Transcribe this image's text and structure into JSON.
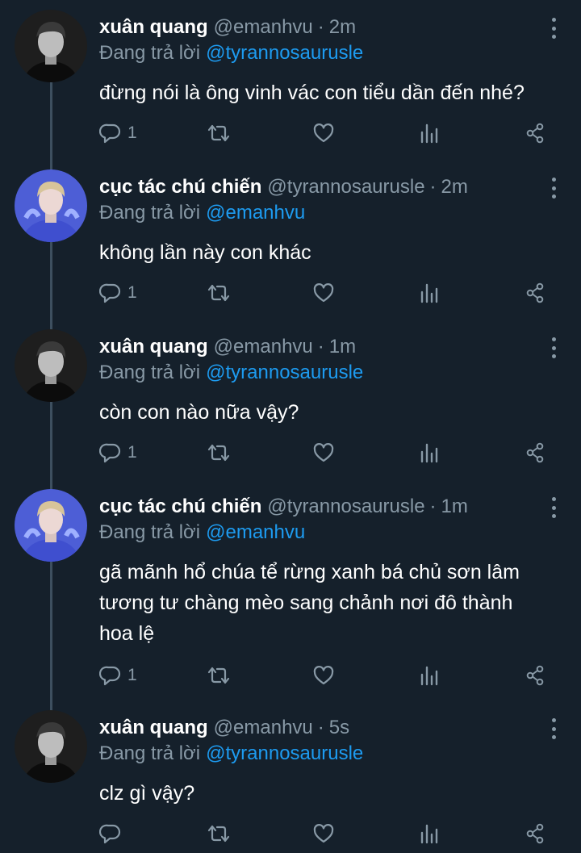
{
  "icons": [
    "reply-icon",
    "retweet-icon",
    "like-icon",
    "analytics-icon",
    "share-icon",
    "more-icon"
  ],
  "colors": {
    "background": "#15202b",
    "muted": "#8899a6",
    "accent": "#1d9bf0",
    "thread_line": "#3d4f5f"
  },
  "replying_label": "Đang trả lời",
  "tweets": [
    {
      "name": "xuân quang",
      "handle": "@emanhvu",
      "separator": "·",
      "time": "2m",
      "replying_to": "@tyrannosaurusle",
      "text": "đừng nói là ông vinh vác con tiểu dần đến nhé?",
      "reply_count": "1"
    },
    {
      "name": "cục tác chú chiến",
      "handle": "@tyrannosaurusle",
      "separator": "·",
      "time": "2m",
      "replying_to": "@emanhvu",
      "text": "không lần này con khác",
      "reply_count": "1"
    },
    {
      "name": "xuân quang",
      "handle": "@emanhvu",
      "separator": "·",
      "time": "1m",
      "replying_to": "@tyrannosaurusle",
      "text": "còn con nào nữa vậy?",
      "reply_count": "1"
    },
    {
      "name": "cục tác chú chiến",
      "handle": "@tyrannosaurusle",
      "separator": "·",
      "time": "1m",
      "replying_to": "@emanhvu",
      "text": "gã mãnh hổ chúa tể rừng xanh bá chủ sơn lâm tương tư chàng mèo sang chảnh nơi đô thành hoa lệ",
      "reply_count": "1"
    },
    {
      "name": "xuân quang",
      "handle": "@emanhvu",
      "separator": "·",
      "time": "5s",
      "replying_to": "@tyrannosaurusle",
      "text": "clz gì vậy?",
      "reply_count": ""
    }
  ]
}
